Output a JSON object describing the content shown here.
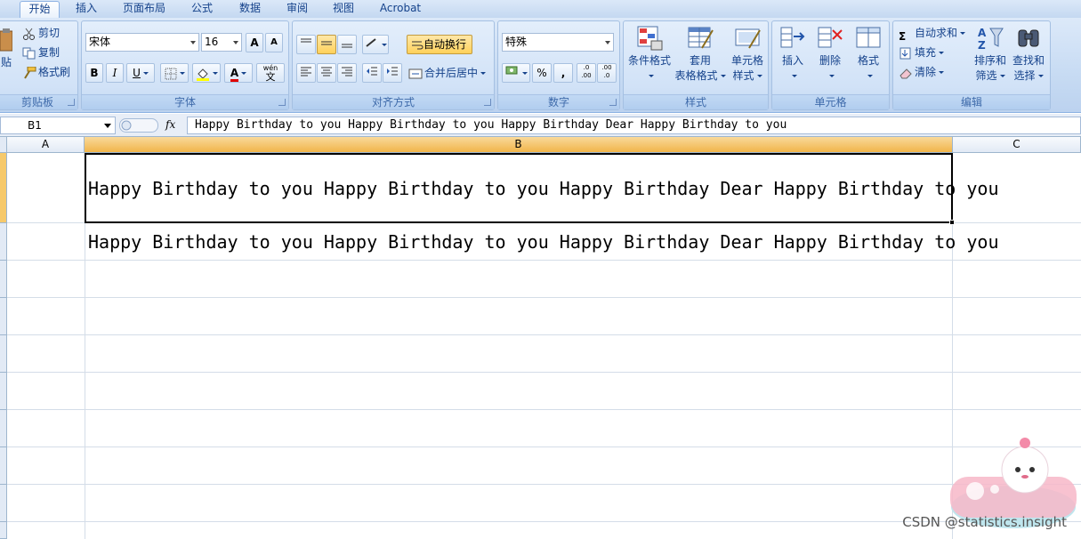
{
  "tabs": [
    {
      "label": "开始",
      "active": true
    },
    {
      "label": "插入"
    },
    {
      "label": "页面布局"
    },
    {
      "label": "公式"
    },
    {
      "label": "数据"
    },
    {
      "label": "审阅"
    },
    {
      "label": "视图"
    },
    {
      "label": "Acrobat"
    }
  ],
  "clipboard": {
    "paste_label": "贴",
    "cut_label": "剪切",
    "copy_label": "复制",
    "format_painter_label": "格式刷",
    "group_label": "剪贴板"
  },
  "font": {
    "family": "宋体",
    "size": "16",
    "grow_label": "A",
    "shrink_label": "A",
    "bold": "B",
    "italic": "I",
    "underline": "U",
    "font_color_label": "A",
    "phonetic_label": "wén",
    "phonetic_char": "文",
    "group_label": "字体"
  },
  "alignment": {
    "wrap_text_label": "自动换行",
    "merge_center_label": "合并后居中",
    "group_label": "对齐方式"
  },
  "number": {
    "format": "特殊",
    "percent_label": "%",
    "comma_label": ",",
    "inc_decimal_label": ".0 .00",
    "dec_decimal_label": ".00 .0",
    "group_label": "数字"
  },
  "styles": {
    "conditional_label": "条件格式",
    "table_label_1": "套用",
    "table_label_2": "表格格式",
    "cell_styles_label_1": "单元格",
    "cell_styles_label_2": "样式",
    "group_label": "样式"
  },
  "cells": {
    "insert_label": "插入",
    "delete_label": "删除",
    "format_label": "格式",
    "group_label": "单元格"
  },
  "editing": {
    "autosum_label": "自动求和",
    "fill_label": "填充",
    "clear_label": "清除",
    "sort_label_1": "排序和",
    "sort_label_2": "筛选",
    "find_label_1": "查找和",
    "find_label_2": "选择",
    "group_label": "编辑"
  },
  "formula_bar": {
    "name_box": "B1",
    "fx_label": "fx",
    "formula": "Happy Birthday to you Happy Birthday to you Happy Birthday Dear Happy Birthday to you"
  },
  "columns": [
    "A",
    "B",
    "C"
  ],
  "cells_data": {
    "b1": "Happy Birthday to you Happy Birthday to you Happy Birthday Dear Happy Birthday to you",
    "b2": "Happy Birthday to you Happy Birthday to you Happy Birthday Dear Happy Birthday to you"
  },
  "watermark": "CSDN @statistics.insight",
  "colors": {
    "ribbon": "#c7dbf3",
    "selected_header": "#f1b54a",
    "grid": "#d4dde8"
  }
}
